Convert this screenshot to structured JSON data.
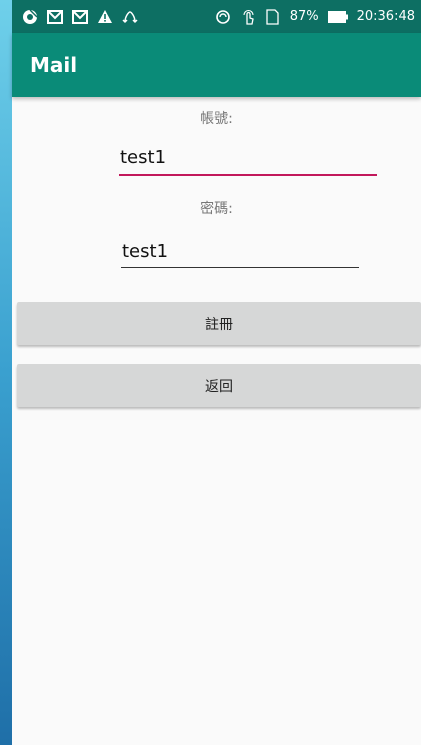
{
  "status_bar": {
    "icons_left": [
      "chrome-icon",
      "gmail-icon",
      "gmail-icon",
      "warning-icon",
      "sync-icon"
    ],
    "icons_right": [
      "sync-circle-icon",
      "touch-icon",
      "sim-card-icon",
      "battery-icon"
    ],
    "battery": "87%",
    "time": "20:36:48"
  },
  "app_bar": {
    "title": "Mail"
  },
  "form": {
    "account_label": "帳號:",
    "account_value": "test1",
    "password_label": "密碼:",
    "password_value": "test1",
    "register_button": "註冊",
    "back_button": "返回"
  },
  "colors": {
    "status_bar": "#0d6f63",
    "app_bar": "#0a8b78",
    "focus_underline": "#c2185b",
    "button": "#d6d7d7"
  }
}
